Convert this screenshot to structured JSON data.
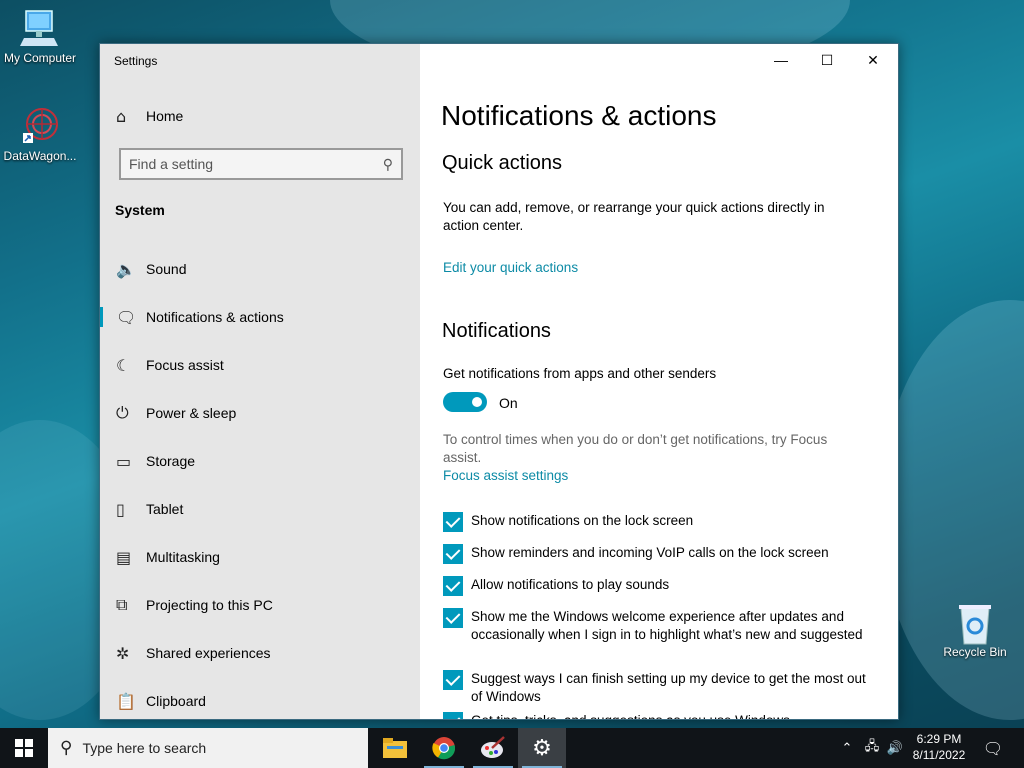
{
  "desktop": {
    "icons": [
      {
        "label": "My Computer"
      },
      {
        "label": "DataWagon..."
      },
      {
        "label": "Recycle Bin"
      }
    ]
  },
  "window": {
    "title": "Settings",
    "controls": {
      "minimize": "—",
      "maximize": "☐",
      "close": "✕"
    }
  },
  "sidebar": {
    "home": "Home",
    "search_placeholder": "Find a setting",
    "section": "System",
    "items": [
      {
        "label": "Sound",
        "icon": "speaker-icon"
      },
      {
        "label": "Notifications & actions",
        "icon": "message-icon",
        "active": true
      },
      {
        "label": "Focus assist",
        "icon": "moon-icon"
      },
      {
        "label": "Power & sleep",
        "icon": "power-icon"
      },
      {
        "label": "Storage",
        "icon": "drive-icon"
      },
      {
        "label": "Tablet",
        "icon": "tablet-icon"
      },
      {
        "label": "Multitasking",
        "icon": "multitask-icon"
      },
      {
        "label": "Projecting to this PC",
        "icon": "project-icon"
      },
      {
        "label": "Shared experiences",
        "icon": "share-icon"
      },
      {
        "label": "Clipboard",
        "icon": "clipboard-icon"
      }
    ]
  },
  "main": {
    "title": "Notifications & actions",
    "quick_actions": {
      "heading": "Quick actions",
      "description": "You can add, remove, or rearrange your quick actions directly in action center.",
      "link": "Edit your quick actions"
    },
    "notifications": {
      "heading": "Notifications",
      "toggle_label": "Get notifications from apps and other senders",
      "toggle_state": "On",
      "focus_hint": "To control times when you do or don’t get notifications, try Focus assist.",
      "focus_link": "Focus assist settings",
      "checkboxes": [
        {
          "label": "Show notifications on the lock screen",
          "checked": true
        },
        {
          "label": "Show reminders and incoming VoIP calls on the lock screen",
          "checked": true
        },
        {
          "label": "Allow notifications to play sounds",
          "checked": true
        },
        {
          "label": "Show me the Windows welcome experience after updates and occasionally when I sign in to highlight what’s new and suggested",
          "checked": true
        },
        {
          "label": "Suggest ways I can finish setting up my device to get the most out of Windows",
          "checked": true
        },
        {
          "label": "Get tips, tricks, and suggestions as you use Windows",
          "checked": true
        }
      ]
    }
  },
  "taskbar": {
    "search_placeholder": "Type here to search",
    "apps": [
      "file-explorer-icon",
      "chrome-icon",
      "paint-icon",
      "settings-icon"
    ],
    "clock": {
      "time": "6:29 PM",
      "date": "8/11/2022"
    }
  },
  "colors": {
    "accent": "#0099bc",
    "link": "#0d8ba6",
    "sidebar": "#e6e6e6",
    "taskbar": "#101418"
  }
}
